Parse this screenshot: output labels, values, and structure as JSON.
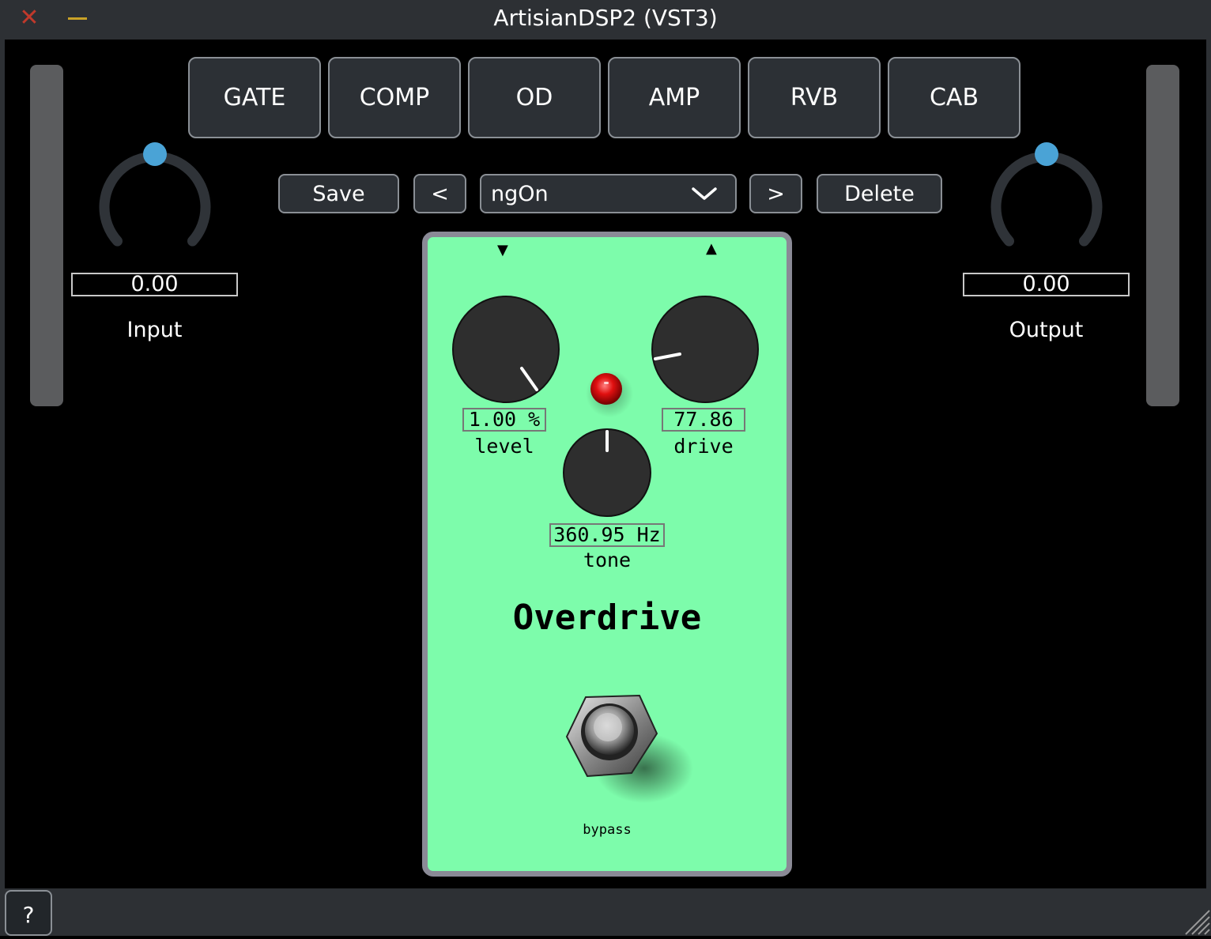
{
  "window": {
    "title": "ArtisianDSP2 (VST3)",
    "close_glyph": "✕",
    "help_label": "?"
  },
  "modules": [
    "GATE",
    "COMP",
    "OD",
    "AMP",
    "RVB",
    "CAB"
  ],
  "presets": {
    "save_label": "Save",
    "prev_label": "<",
    "current": "ngOn",
    "next_label": ">",
    "delete_label": "Delete"
  },
  "input": {
    "label": "Input",
    "value": "0.00"
  },
  "output": {
    "label": "Output",
    "value": "0.00"
  },
  "pedal": {
    "name": "Overdrive",
    "color": "#7dfcab",
    "level": {
      "value": "1.00 %",
      "label": "level"
    },
    "drive": {
      "value": "77.86",
      "label": "drive"
    },
    "tone": {
      "value": "360.95 Hz",
      "label": "tone"
    },
    "bypass_label": "bypass",
    "led": "on"
  },
  "colors": {
    "accent": "#4aa3d6",
    "led": "#e01010",
    "panel": "#2c3035"
  }
}
